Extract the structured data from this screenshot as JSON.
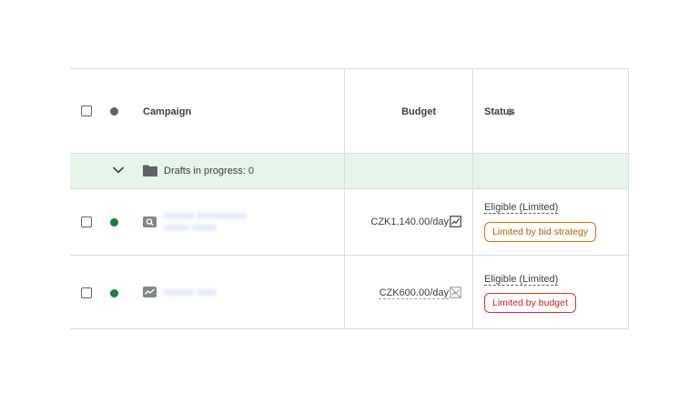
{
  "header": {
    "campaign": "Campaign",
    "budget": "Budget",
    "status": "Status"
  },
  "drafts": {
    "label": "Drafts in progress: 0"
  },
  "rows": [
    {
      "name_line1": "xxxxxx xxxxxxxxxx",
      "name_line2": "xxxxx xxxxx",
      "type_icon": "search-campaign-icon",
      "budget": "CZK1,140.00/day",
      "status": "Eligible (Limited)",
      "badge": "Limited by bid strategy",
      "badge_color": "#e37400"
    },
    {
      "name_line1": "xxxxxx xxxx",
      "type_icon": "performance-campaign-icon",
      "budget": "CZK600.00/day",
      "status": "Eligible (Limited)",
      "badge": "Limited by budget",
      "badge_color": "#d93025"
    }
  ],
  "colors": {
    "enabled": "#188038",
    "drafts_bg": "#e6f4ea",
    "border": "#dadce0"
  }
}
